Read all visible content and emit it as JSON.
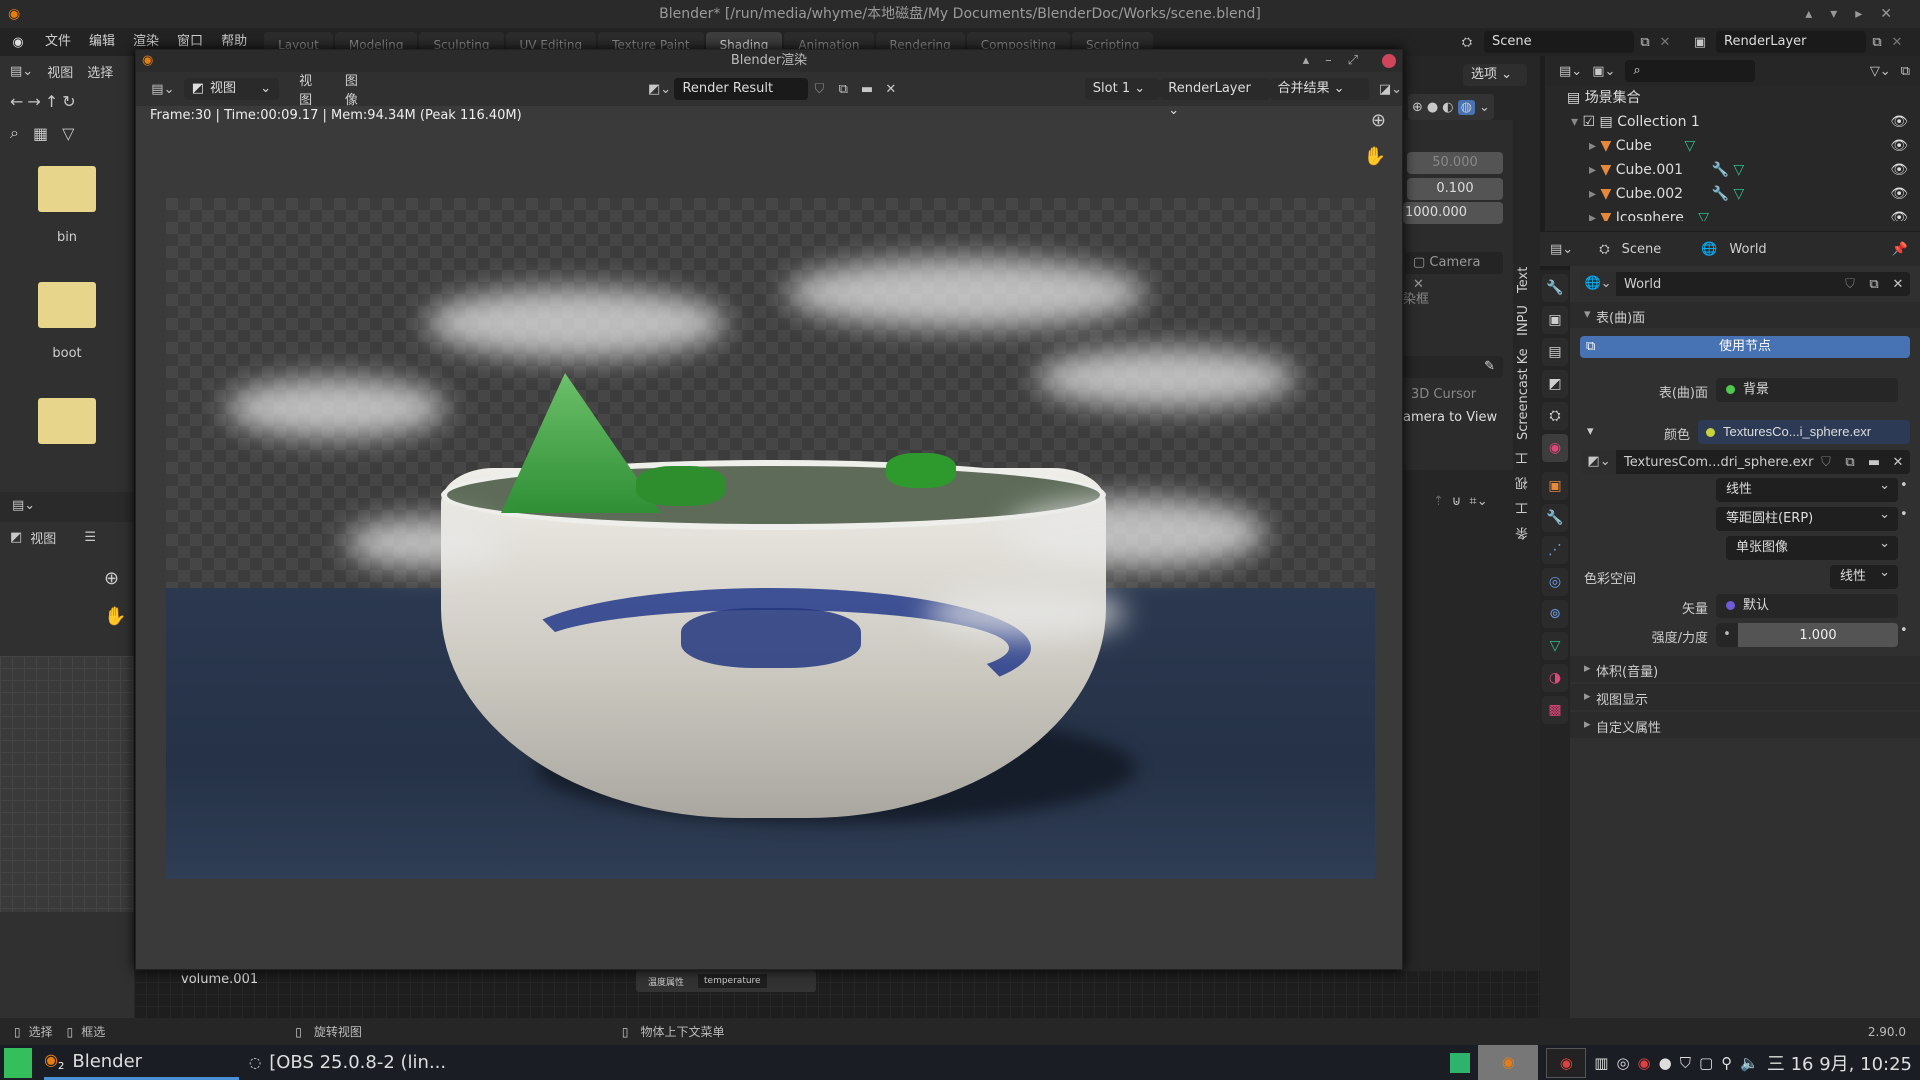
{
  "window": {
    "title": "Blender* [/run/media/whyme/本地磁盘/My Documents/BlenderDoc/Works/scene.blend]"
  },
  "menubar": {
    "items": [
      "文件",
      "编辑",
      "渲染",
      "窗口",
      "帮助"
    ],
    "workspaces": [
      "Layout",
      "Modeling",
      "Sculpting",
      "UV Editing",
      "Texture Paint",
      "Shading",
      "Animation",
      "Rendering",
      "Compositing",
      "Scripting"
    ],
    "active_workspace": "Shading",
    "scene": "Scene",
    "render_layer": "RenderLayer"
  },
  "left_panel": {
    "header_items": [
      "视图",
      "选择"
    ],
    "files": [
      {
        "name": "bin"
      },
      {
        "name": "boot"
      },
      {
        "name": ""
      }
    ],
    "view_label": "视图"
  },
  "render_window": {
    "title": "Blender渲染",
    "menu": [
      "视图",
      "图像"
    ],
    "view_select": "视图",
    "image_name": "Render Result",
    "slot": "Slot 1",
    "layer": "RenderLayer",
    "pass": "合并结果",
    "stats": "Frame:30 | Time:00:09.17 | Mem:94.34M (Peak 116.40M)"
  },
  "viewport": {
    "options_label": "选项",
    "fields": [
      "50.000",
      "0.100",
      "1000.000"
    ],
    "camera": "Camera",
    "border_label": "染框",
    "cursor_label": "3D Cursor",
    "cam_to_view": "amera to View",
    "side_tabs": [
      "条",
      "工",
      "视",
      "工",
      "Screencast Ke",
      "INPU",
      "Text"
    ]
  },
  "node_editor": {
    "object_label": "volume.001",
    "node_label": "温度属性",
    "node_value": "temperature"
  },
  "outliner": {
    "root": "场景集合",
    "items": [
      {
        "name": "Collection 1",
        "type": "collection"
      },
      {
        "name": "Cube",
        "modifier": false
      },
      {
        "name": "Cube.001",
        "modifier": true
      },
      {
        "name": "Cube.002",
        "modifier": true
      },
      {
        "name": "Icosphere",
        "modifier": false
      }
    ]
  },
  "properties": {
    "breadcrumb": [
      "Scene",
      "World"
    ],
    "world_name": "World",
    "surface_section": "表(曲)面",
    "use_nodes": "使用节点",
    "surface_label": "表(曲)面",
    "surface_value": "背景",
    "color_label": "颜色",
    "color_value": "TexturesCo...i_sphere.exr",
    "image_name": "TexturesCom...dri_sphere.exr",
    "interpolation": "线性",
    "projection": "等距圆柱(ERP)",
    "source": "单张图像",
    "colorspace_label": "色彩空间",
    "colorspace_value": "线性",
    "vector_label": "矢量",
    "vector_value": "默认",
    "strength_label": "强度/力度",
    "strength_value": "1.000",
    "collapsed_sections": [
      "体积(音量)",
      "视图显示",
      "自定义属性"
    ],
    "colors": {
      "surface_dot": "#4ec94e",
      "color_dot": "#c8d23a",
      "vector_dot": "#6f5bd6",
      "accent": "#4772b3"
    }
  },
  "statusbar": {
    "select": "选择",
    "box_select": "框选",
    "rotate": "旋转视图",
    "context_menu": "物体上下文菜单",
    "version": "2.90.0"
  },
  "taskbar": {
    "app1": "Blender",
    "app1_badge": "2",
    "app2": "[OBS 25.0.8-2 (lin...",
    "clock": "三 16 9月, 10:25"
  }
}
